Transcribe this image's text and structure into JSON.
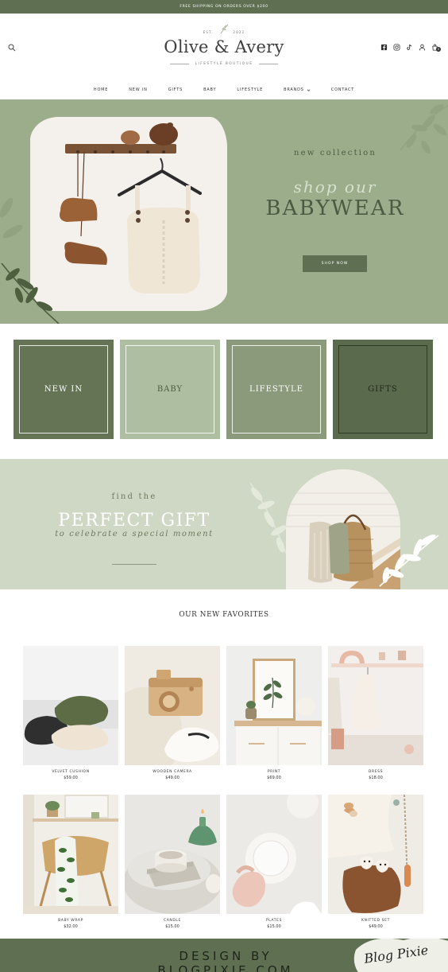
{
  "announcement": "FREE SHIPPING ON ORDERS OVER $200",
  "brand": {
    "est_left": "EST.",
    "est_right": "2022",
    "name": "Olive & Avery",
    "tagline": "LIFESTYLE BOUTIQUE"
  },
  "header_icons": [
    "search-icon",
    "facebook-icon",
    "instagram-icon",
    "tiktok-icon",
    "user-icon",
    "cart-icon"
  ],
  "cart_count": "0",
  "nav": {
    "items": [
      "HOME",
      "NEW IN",
      "GIFTS",
      "BABY",
      "LIFESTYLE",
      "BRANDS",
      "CONTACT"
    ],
    "brands_has_dropdown": true
  },
  "hero": {
    "eyebrow": "new collection",
    "script": "shop our",
    "title": "BABYWEAR",
    "button": "SHOP NOW",
    "bg_color": "#9cad8c"
  },
  "categories": [
    {
      "label": "NEW IN",
      "color": "#647455"
    },
    {
      "label": "BABY",
      "color": "#aebea0"
    },
    {
      "label": "LIFESTYLE",
      "color": "#8a9a7a"
    },
    {
      "label": "GIFTS",
      "color": "#5a6a4c"
    }
  ],
  "gift": {
    "eyebrow": "find the",
    "title": "PERFECT GIFT",
    "script": "to celebrate a special moment"
  },
  "favorites": {
    "title": "OUR NEW FAVORITES",
    "products": [
      {
        "name": "VELVET CUSHION",
        "price": "$59.00"
      },
      {
        "name": "WOODEN CAMERA",
        "price": "$49.00"
      },
      {
        "name": "PRINT",
        "price": "$69.00"
      },
      {
        "name": "DRESS",
        "price": "$18.00"
      },
      {
        "name": "BABY WRAP",
        "price": "$32.00"
      },
      {
        "name": "CANDLE",
        "price": "$15.00"
      },
      {
        "name": "PLATES",
        "price": "$15.00"
      },
      {
        "name": "KNITTED SET",
        "price": "$49.00"
      }
    ]
  },
  "footer": {
    "text": "DESIGN BY BLOGPIXIE.COM",
    "signature": "Blog Pixie"
  },
  "colors": {
    "primary_green": "#5f6f52",
    "sage": "#9cad8c",
    "light_sage": "#cfd8c4"
  }
}
